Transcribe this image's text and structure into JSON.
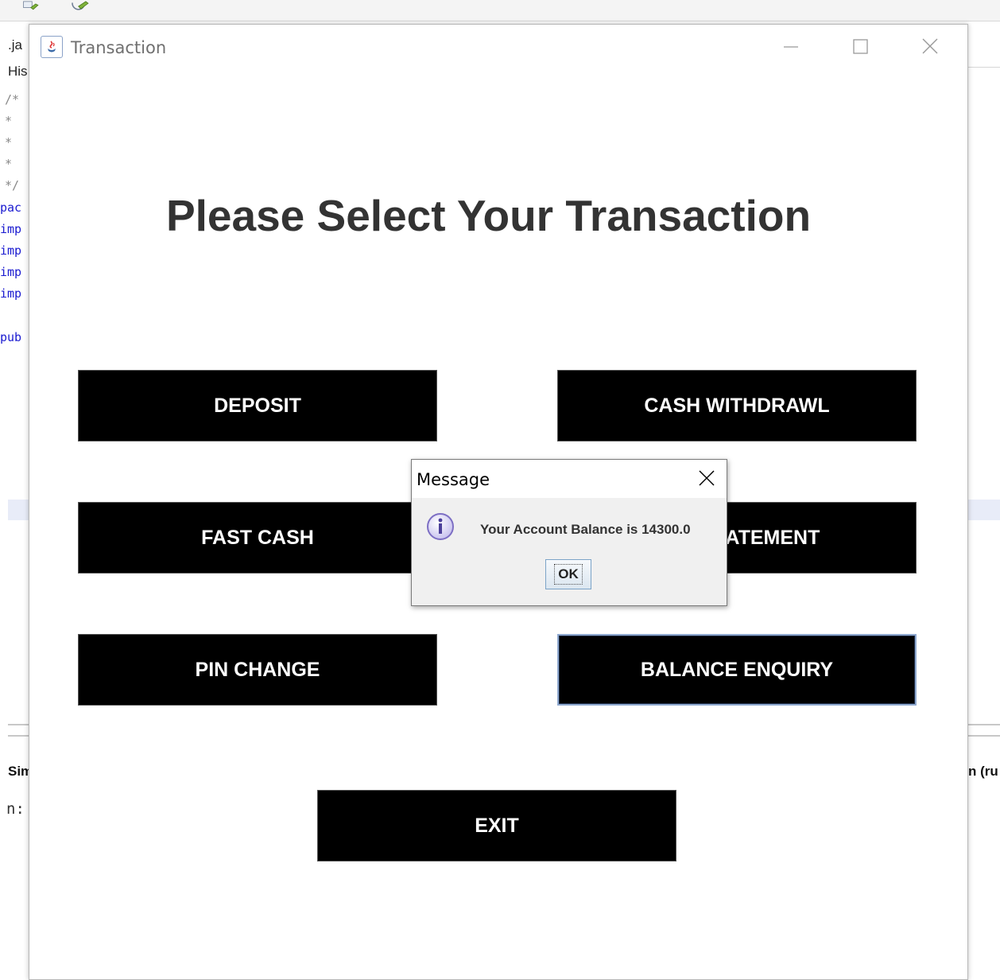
{
  "ide": {
    "tab_label": ".ja",
    "history_label": "His",
    "code_lines": [
      "/*",
      " *",
      " *",
      " *",
      " */",
      "pac",
      "imp",
      "imp",
      "imp",
      "imp",
      "",
      "pub"
    ],
    "output_label": "Sim",
    "output_prefix": "n:",
    "right_output_label": "n (ru"
  },
  "window": {
    "title": "Transaction",
    "headline": "Please Select Your Transaction"
  },
  "buttons": {
    "deposit": "DEPOSIT",
    "cash_withdrawl": "CASH WITHDRAWL",
    "fast_cash": "FAST CASH",
    "mini_statement": "MINI STATEMENT",
    "pin_change": "PIN CHANGE",
    "balance_enquiry": "BALANCE ENQUIRY",
    "exit": "EXIT"
  },
  "dialog": {
    "title": "Message",
    "message": "Your Account Balance is 14300.0",
    "ok_label": "OK"
  },
  "colors": {
    "button_bg": "#000000",
    "button_text": "#ffffff",
    "headline": "#333333",
    "dialog_bg": "#f0f0f0",
    "focus_border": "#8fa9cf"
  }
}
